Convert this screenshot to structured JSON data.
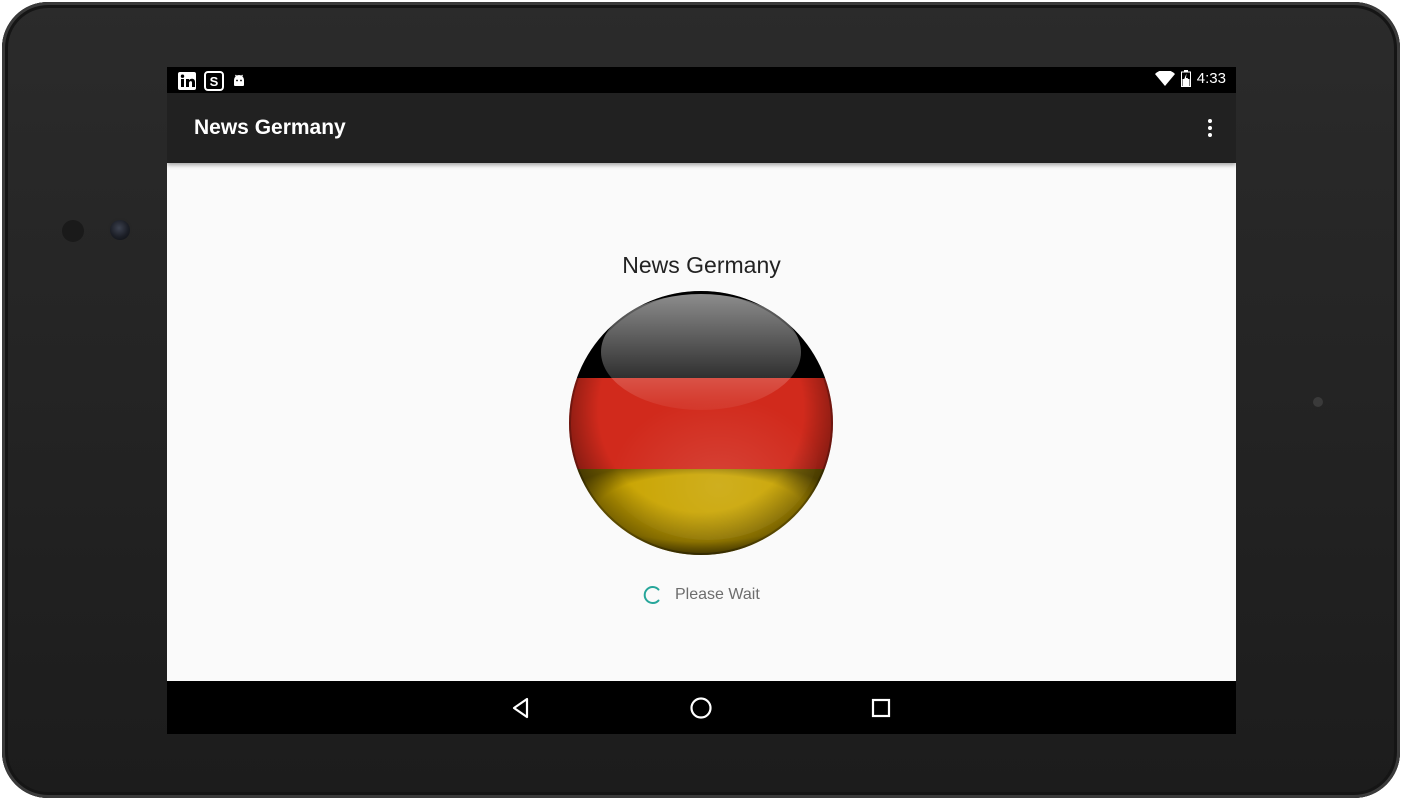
{
  "status_bar": {
    "time": "4:33",
    "left_icons": [
      "linkedin-icon",
      "news-app-icon",
      "android-icon"
    ],
    "right_icons": [
      "wifi-icon",
      "battery-icon"
    ]
  },
  "toolbar": {
    "title": "News Germany",
    "menu_icon": "more-vert-icon"
  },
  "content": {
    "title": "News Germany",
    "logo": "germany-flag-globe",
    "loading_text": "Please Wait",
    "spinner_color": "#26a69a"
  },
  "flag_colors": {
    "black": "#000000",
    "red": "#dd0000",
    "gold": "#ffce00"
  },
  "nav_bar": {
    "buttons": [
      "back-icon",
      "home-icon",
      "recents-icon"
    ]
  }
}
